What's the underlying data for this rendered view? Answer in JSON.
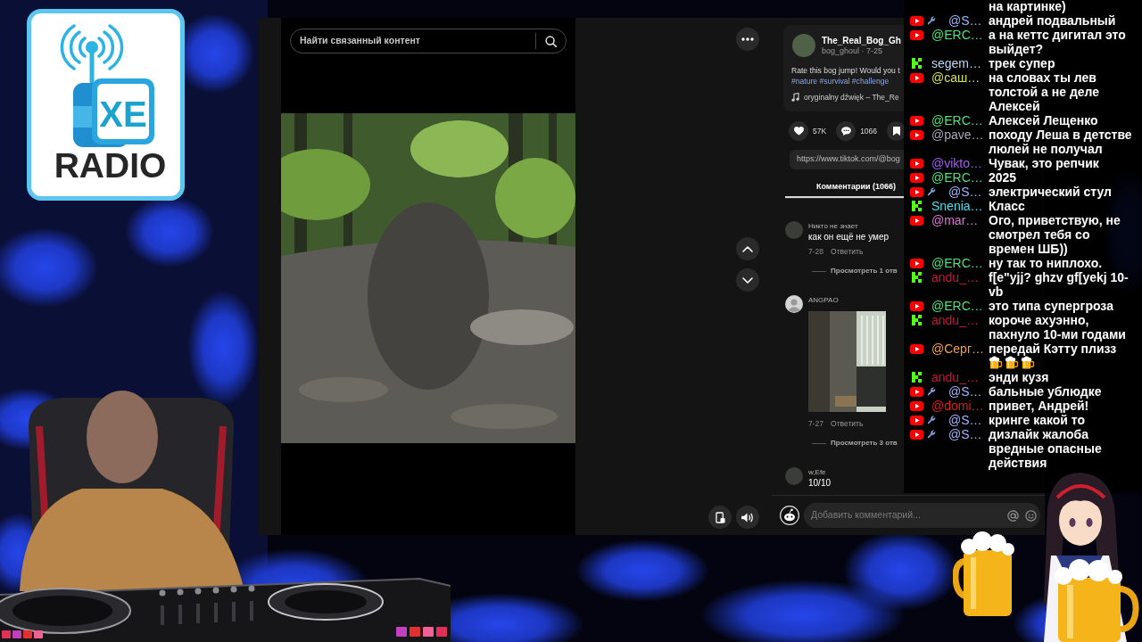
{
  "logo": {
    "mark": "XE",
    "name": "RADIO"
  },
  "browser": {
    "search": {
      "placeholder": "Найти связанный контент"
    },
    "post": {
      "author": "The_Real_Bog_Gh",
      "meta": "bog_ghoul · 7-25",
      "description": "Rate this bog jump! Would you t",
      "hashtags": "#nature #survival #challenge",
      "sound": "oryginalny dźwięk – The_Re",
      "likes": "57K",
      "comment_count": "1066",
      "link": "https://www.tiktok.com/@bog"
    },
    "tabs": [
      {
        "label": "Комментарии (1066)",
        "selected": true
      }
    ],
    "comments": [
      {
        "kind": "text",
        "default_avatar": false,
        "author": "Никто не знает",
        "text": "как он ещё не умер",
        "date": "7-28",
        "reply": "Ответить",
        "view_replies": "Просмотреть 1 отв"
      },
      {
        "kind": "image",
        "default_avatar": true,
        "author": "ANGPAO",
        "date": "7-27",
        "reply": "Ответить",
        "view_replies": "Просмотреть 3 отв"
      },
      {
        "kind": "text",
        "default_avatar": false,
        "author": "w,Efe",
        "text": "10/10"
      }
    ],
    "comment_input": {
      "placeholder": "Добавить комментарий..."
    }
  },
  "chat": [
    {
      "kind": "fragment",
      "text": "на картинке)"
    },
    {
      "kind": "youtube",
      "moderator": true,
      "user": "@S…",
      "color": "#a3b4ff",
      "text": "андрей подвальный"
    },
    {
      "kind": "youtube",
      "moderator": false,
      "user": "@ERC…",
      "color": "#4fe07a",
      "text": "а на кеттс дигитал это выйдет?"
    },
    {
      "kind": "kick",
      "moderator": false,
      "user": "segem…",
      "color": "#b9d7f5",
      "text": "трек супер"
    },
    {
      "kind": "youtube",
      "moderator": false,
      "user": "@саш…",
      "color": "#d6e05a",
      "text": "на словах ты лев толстой а не деле Алексей"
    },
    {
      "kind": "youtube",
      "moderator": false,
      "user": "@ERC…",
      "color": "#4fe07a",
      "text": "Алексей Лещенко"
    },
    {
      "kind": "youtube",
      "moderator": false,
      "user": "@pave…",
      "color": "#a9a9b8",
      "text": "походу Леша в детстве люлей не получал"
    },
    {
      "kind": "youtube",
      "moderator": false,
      "user": "@vikto…",
      "color": "#a25cf0",
      "text": "Чувак, это репчик"
    },
    {
      "kind": "youtube",
      "moderator": false,
      "user": "@ERC…",
      "color": "#4fe07a",
      "text": "2025"
    },
    {
      "kind": "youtube",
      "moderator": true,
      "user": "@S…",
      "color": "#a3b4ff",
      "text": "электрический стул"
    },
    {
      "kind": "kick",
      "moderator": false,
      "user": "Snenia…",
      "color": "#3ee3f2",
      "text": "Класс"
    },
    {
      "kind": "youtube",
      "moderator": false,
      "user": "@mar…",
      "color": "#e076d6",
      "text": "Ого, приветствую, не смотрел тебя со времен ШБ))"
    },
    {
      "kind": "youtube",
      "moderator": false,
      "user": "@ERC…",
      "color": "#4fe07a",
      "text": "ну так то ниплохо."
    },
    {
      "kind": "kick",
      "moderator": false,
      "user": "andu_…",
      "color": "#c8183a",
      "text": "f[e\"yjj? ghzv gf[yekj 10-vb"
    },
    {
      "kind": "youtube",
      "moderator": false,
      "user": "@ERC…",
      "color": "#4fe07a",
      "text": "это типа супергроза"
    },
    {
      "kind": "kick",
      "moderator": false,
      "user": "andu_…",
      "color": "#c8183a",
      "text": "короче ахуэнно, пахнуло 10-ми годами"
    },
    {
      "kind": "youtube",
      "moderator": false,
      "user": "@Серг…",
      "color": "#f2a04e",
      "text": "передай Кэтту плизз",
      "emotes": [
        {
          "kind": "beer"
        },
        {
          "kind": "beer"
        },
        {
          "kind": "beer"
        }
      ]
    },
    {
      "kind": "kick",
      "moderator": false,
      "user": "andu_…",
      "color": "#c8183a",
      "text": "энди кузя"
    },
    {
      "kind": "youtube",
      "moderator": true,
      "user": "@S…",
      "color": "#a3b4ff",
      "text": "бальные ублюдке"
    },
    {
      "kind": "youtube",
      "moderator": false,
      "user": "@domi…",
      "color": "#e01b1b",
      "text": "привет, Андрей!"
    },
    {
      "kind": "youtube",
      "moderator": true,
      "user": "@S…",
      "color": "#a3b4ff",
      "text": "кринге какой то"
    },
    {
      "kind": "youtube",
      "moderator": true,
      "user": "@S…",
      "color": "#a3b4ff",
      "text": "дизлайк жалоба вредные опасные действия"
    }
  ]
}
